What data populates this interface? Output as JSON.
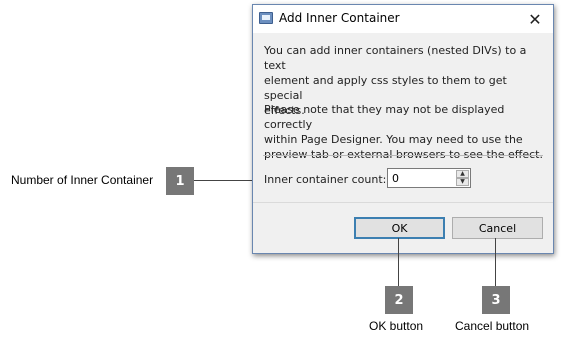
{
  "dialog": {
    "title": "Add Inner Container",
    "close_glyph": "✕",
    "intro_lines": [
      "You can add inner containers (nested DIVs) to a text",
      "element and apply css styles to them to get special",
      "effects."
    ],
    "note_lines": [
      "Please note that they may not be displayed correctly",
      "within Page Designer. You may need to use the",
      "preview tab or external browsers to see the effect."
    ],
    "count_label": "Inner container count:",
    "count_value": "0",
    "ok_label": "OK",
    "cancel_label": "Cancel"
  },
  "callouts": [
    {
      "number": "1",
      "text": "Number of Inner Container"
    },
    {
      "number": "2",
      "text": "OK button"
    },
    {
      "number": "3",
      "text": "Cancel button"
    }
  ],
  "icons": {
    "app": "window-icon",
    "close": "close-icon",
    "spin_up": "caret-up-icon",
    "spin_down": "caret-down-icon"
  },
  "colors": {
    "dialog_border": "#6a87b0",
    "ok_focus_border": "#3c7fb1",
    "badge": "#777777"
  }
}
